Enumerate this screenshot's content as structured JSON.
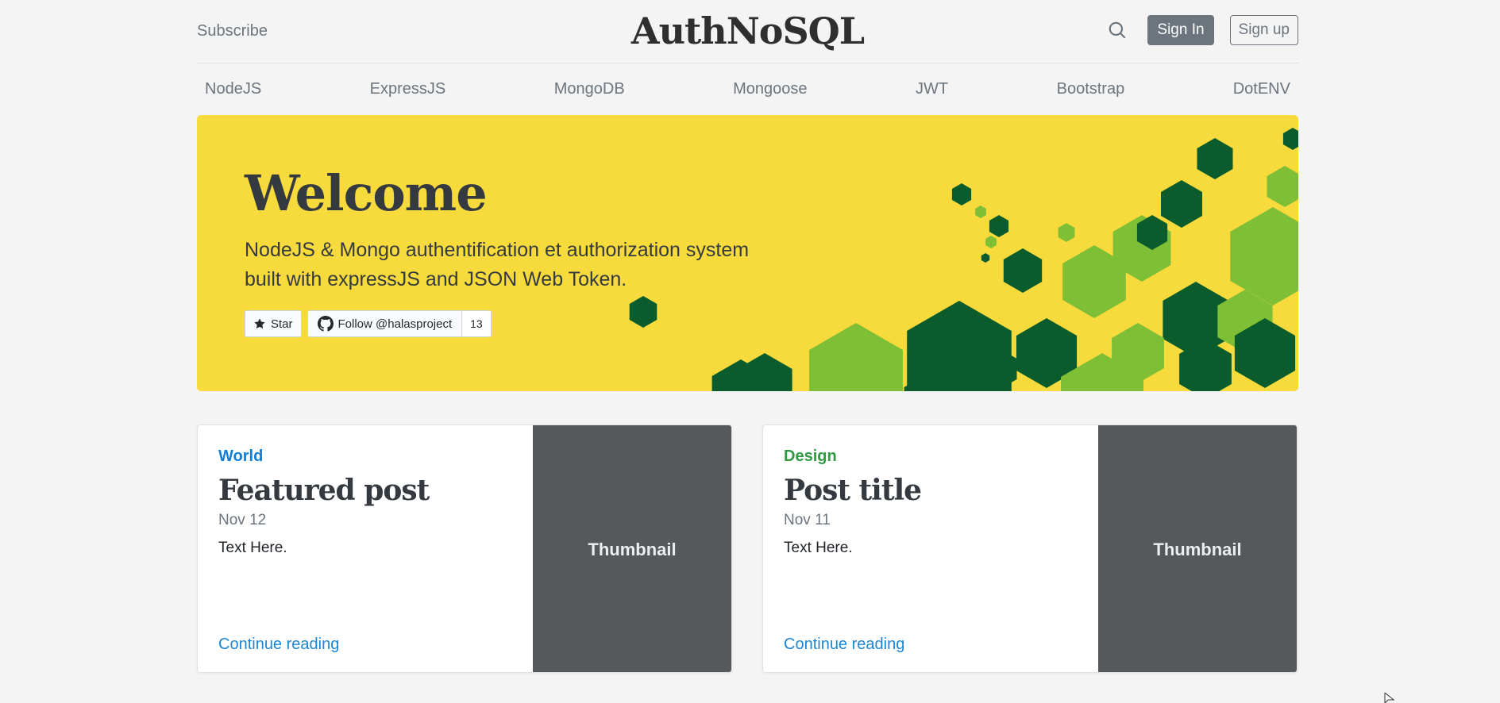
{
  "header": {
    "subscribe": "Subscribe",
    "brand": "AuthNoSQL",
    "search_icon": "search-icon",
    "sign_in": "Sign In",
    "sign_up": "Sign up"
  },
  "nav": {
    "items": [
      "NodeJS",
      "ExpressJS",
      "MongoDB",
      "Mongoose",
      "JWT",
      "Bootstrap",
      "DotENV"
    ]
  },
  "hero": {
    "title": "Welcome",
    "lead": "NodeJS & Mongo authentification et authorization system built with expressJS and JSON Web Token.",
    "star_label": "Star",
    "follow_label": "Follow @halasproject",
    "follow_count": "13"
  },
  "cards": [
    {
      "category": "World",
      "category_color": "#0d7fdb",
      "title": "Featured post",
      "date": "Nov 12",
      "text": "Text Here.",
      "link": "Continue reading",
      "thumbnail": "Thumbnail"
    },
    {
      "category": "Design",
      "category_color": "#2f9a40",
      "title": "Post title",
      "date": "Nov 11",
      "text": "Text Here.",
      "link": "Continue reading",
      "thumbnail": "Thumbnail"
    }
  ],
  "colors": {
    "hero_bg": "#f7db3c",
    "hex_dark": "#0b5c2c",
    "hex_light": "#7fbf35",
    "link": "#1c86d6",
    "thumb_bg": "#55595c"
  }
}
